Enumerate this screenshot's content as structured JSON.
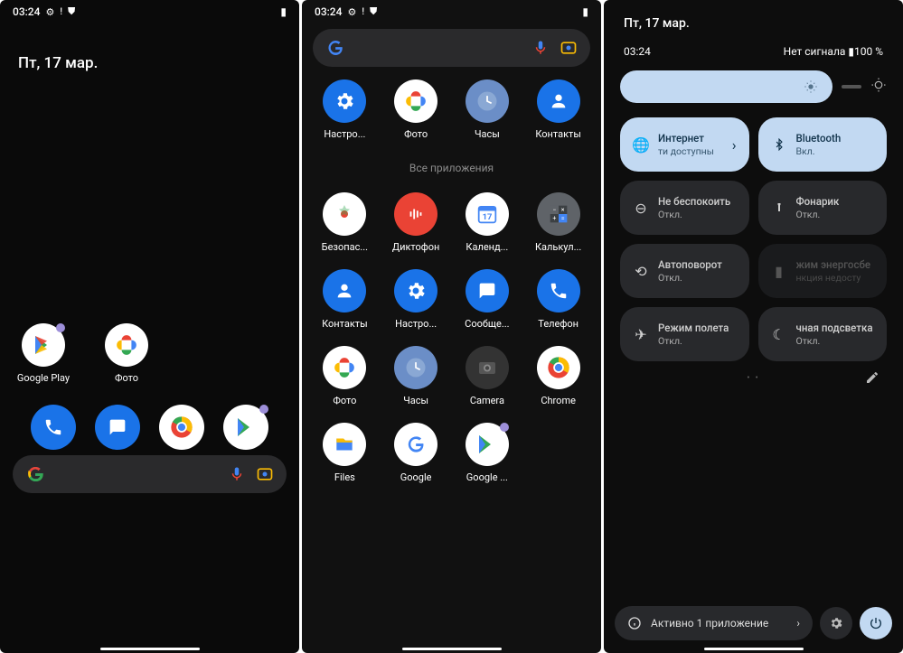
{
  "status": {
    "time": "03:24"
  },
  "home": {
    "date": "Пт, 17 мар.",
    "row": [
      {
        "label": "Google Play"
      },
      {
        "label": "Фото"
      }
    ],
    "search_placeholder": ""
  },
  "drawer": {
    "favorites": [
      {
        "label": "Настро..."
      },
      {
        "label": "Фото"
      },
      {
        "label": "Часы"
      },
      {
        "label": "Контакты"
      }
    ],
    "all_label": "Все приложения",
    "apps": [
      {
        "label": "Безопас..."
      },
      {
        "label": "Диктофон"
      },
      {
        "label": "Календ..."
      },
      {
        "label": "Калькул..."
      },
      {
        "label": "Контакты"
      },
      {
        "label": "Настро..."
      },
      {
        "label": "Сообще..."
      },
      {
        "label": "Телефон"
      },
      {
        "label": "Фото"
      },
      {
        "label": "Часы"
      },
      {
        "label": "Camera"
      },
      {
        "label": "Chrome"
      },
      {
        "label": "Files"
      },
      {
        "label": "Google"
      },
      {
        "label": "Google ..."
      }
    ]
  },
  "qs": {
    "date": "Пт, 17 мар.",
    "time": "03:24",
    "signal": "Нет сигнала",
    "battery": "100 %",
    "tiles": [
      {
        "title": "Интернет",
        "sub": "ти доступны"
      },
      {
        "title": "Bluetooth",
        "sub": "Вкл."
      },
      {
        "title": "Не беспокоить",
        "sub": "Откл."
      },
      {
        "title": "Фонарик",
        "sub": "Откл."
      },
      {
        "title": "Автоповорот",
        "sub": "Откл."
      },
      {
        "title": "жим энергосбе",
        "sub": "нкция недосту"
      },
      {
        "title": "Режим полета",
        "sub": "Откл."
      },
      {
        "title": "чная подсветка",
        "sub": "Откл."
      }
    ],
    "footer": "Активно 1 приложение"
  }
}
